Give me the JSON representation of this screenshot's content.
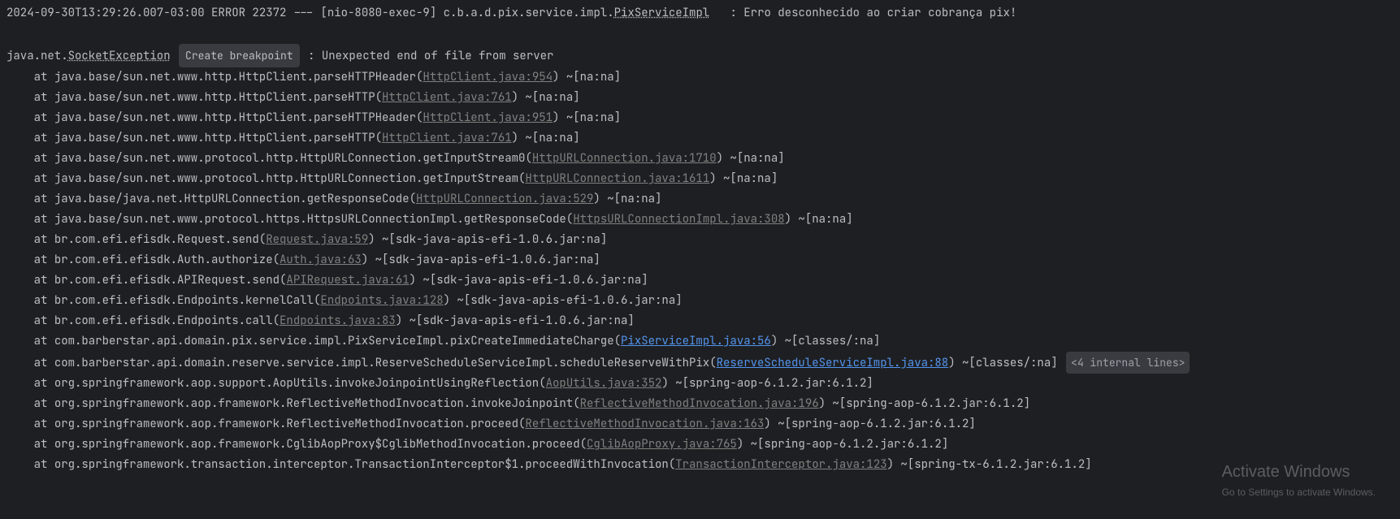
{
  "header": {
    "timestamp": "2024-09-30T13:29:26.007-03:00",
    "level": "ERROR",
    "pid": "22372",
    "sep": "---",
    "thread": "[nio-8080-exec-9]",
    "logger_prefix": "c.b.a.d.pix.service.impl.",
    "logger_class": "PixServiceImpl",
    "message": "   : Erro desconhecido ao criar cobrança pix!"
  },
  "exception": {
    "prefix": "java.net.",
    "class": "SocketException",
    "badge": "Create breakpoint",
    "message": " : Unexpected end of file from server"
  },
  "frames": [
    {
      "indent": "    at ",
      "pre": "java.base/sun.net.www.http.HttpClient.parseHTTPHeader(",
      "link": "HttpClient.java:954",
      "lc": "link",
      "post": ") ~[na:na]"
    },
    {
      "indent": "    at ",
      "pre": "java.base/sun.net.www.http.HttpClient.parseHTTP(",
      "link": "HttpClient.java:761",
      "lc": "link",
      "post": ") ~[na:na]"
    },
    {
      "indent": "    at ",
      "pre": "java.base/sun.net.www.http.HttpClient.parseHTTPHeader(",
      "link": "HttpClient.java:951",
      "lc": "link",
      "post": ") ~[na:na]"
    },
    {
      "indent": "    at ",
      "pre": "java.base/sun.net.www.http.HttpClient.parseHTTP(",
      "link": "HttpClient.java:761",
      "lc": "link",
      "post": ") ~[na:na]"
    },
    {
      "indent": "    at ",
      "pre": "java.base/sun.net.www.protocol.http.HttpURLConnection.getInputStream0(",
      "link": "HttpURLConnection.java:1710",
      "lc": "link",
      "post": ") ~[na:na]"
    },
    {
      "indent": "    at ",
      "pre": "java.base/sun.net.www.protocol.http.HttpURLConnection.getInputStream(",
      "link": "HttpURLConnection.java:1611",
      "lc": "link",
      "post": ") ~[na:na]"
    },
    {
      "indent": "    at ",
      "pre": "java.base/java.net.HttpURLConnection.getResponseCode(",
      "link": "HttpURLConnection.java:529",
      "lc": "link",
      "post": ") ~[na:na]"
    },
    {
      "indent": "    at ",
      "pre": "java.base/sun.net.www.protocol.https.HttpsURLConnectionImpl.getResponseCode(",
      "link": "HttpsURLConnectionImpl.java:308",
      "lc": "link",
      "post": ") ~[na:na]"
    },
    {
      "indent": "    at ",
      "pre": "br.com.efi.efisdk.Request.send(",
      "link": "Request.java:59",
      "lc": "link",
      "post": ") ~[sdk-java-apis-efi-1.0.6.jar:na]"
    },
    {
      "indent": "    at ",
      "pre": "br.com.efi.efisdk.Auth.authorize(",
      "link": "Auth.java:63",
      "lc": "link",
      "post": ") ~[sdk-java-apis-efi-1.0.6.jar:na]"
    },
    {
      "indent": "    at ",
      "pre": "br.com.efi.efisdk.APIRequest.send(",
      "link": "APIRequest.java:61",
      "lc": "link",
      "post": ") ~[sdk-java-apis-efi-1.0.6.jar:na]"
    },
    {
      "indent": "    at ",
      "pre": "br.com.efi.efisdk.Endpoints.kernelCall(",
      "link": "Endpoints.java:128",
      "lc": "link",
      "post": ") ~[sdk-java-apis-efi-1.0.6.jar:na]"
    },
    {
      "indent": "    at ",
      "pre": "br.com.efi.efisdk.Endpoints.call(",
      "link": "Endpoints.java:83",
      "lc": "link",
      "post": ") ~[sdk-java-apis-efi-1.0.6.jar:na]"
    },
    {
      "indent": "    at ",
      "pre": "com.barberstar.api.domain.pix.service.impl.PixServiceImpl.pixCreateImmediateCharge(",
      "link": "PixServiceImpl.java:56",
      "lc": "link-blue",
      "post": ") ~[classes/:na]"
    },
    {
      "indent": "    at ",
      "pre": "com.barberstar.api.domain.reserve.service.impl.ReserveScheduleServiceImpl.scheduleReserveWithPix(",
      "link": "ReserveScheduleServiceImpl.java:88",
      "lc": "link-blue",
      "post": ") ~[classes/:na] ",
      "badge": "<4 internal lines>"
    },
    {
      "indent": "    at ",
      "pre": "org.springframework.aop.support.AopUtils.invokeJoinpointUsingReflection(",
      "link": "AopUtils.java:352",
      "lc": "link",
      "post": ") ~[spring-aop-6.1.2.jar:6.1.2]"
    },
    {
      "indent": "    at ",
      "pre": "org.springframework.aop.framework.ReflectiveMethodInvocation.invokeJoinpoint(",
      "link": "ReflectiveMethodInvocation.java:196",
      "lc": "link",
      "post": ") ~[spring-aop-6.1.2.jar:6.1.2]"
    },
    {
      "indent": "    at ",
      "pre": "org.springframework.aop.framework.ReflectiveMethodInvocation.proceed(",
      "link": "ReflectiveMethodInvocation.java:163",
      "lc": "link",
      "post": ") ~[spring-aop-6.1.2.jar:6.1.2]"
    },
    {
      "indent": "    at ",
      "pre": "org.springframework.aop.framework.CglibAopProxy$CglibMethodInvocation.proceed(",
      "link": "CglibAopProxy.java:765",
      "lc": "link",
      "post": ") ~[spring-aop-6.1.2.jar:6.1.2]"
    },
    {
      "indent": "    at ",
      "pre": "org.springframework.transaction.interceptor.TransactionInterceptor$1.proceedWithInvocation(",
      "link": "TransactionInterceptor.java:123",
      "lc": "link",
      "post": ") ~[spring-tx-6.1.2.jar:6.1.2]"
    }
  ],
  "watermark": {
    "title": "Activate Windows",
    "sub": "Go to Settings to activate Windows."
  }
}
